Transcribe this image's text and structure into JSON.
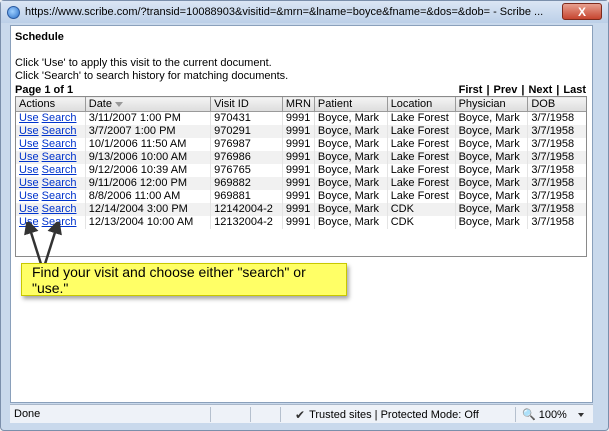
{
  "window": {
    "title": "https://www.scribe.com/?transid=10088903&visitid=&mrn=&lname=boyce&fname=&dos=&dob= - Scribe ...",
    "close_label": "X"
  },
  "page": {
    "title": "Schedule",
    "instruction_use": "Click 'Use' to apply this visit to the current document.",
    "instruction_search": "Click 'Search' to search history for matching documents.",
    "page_info": "Page 1 of 1"
  },
  "pager": {
    "first": "First",
    "prev": "Prev",
    "next": "Next",
    "last": "Last",
    "sep": "|"
  },
  "table": {
    "headers": {
      "actions": "Actions",
      "date": "Date",
      "visit_id": "Visit ID",
      "mrn": "MRN",
      "patient": "Patient",
      "location": "Location",
      "physician": "Physician",
      "dob": "DOB"
    },
    "use_label": "Use",
    "search_label": "Search",
    "rows": [
      {
        "date": "3/11/2007 1:00 PM",
        "visit_id": "970431",
        "mrn": "9991",
        "patient": "Boyce, Mark",
        "location": "Lake Forest",
        "physician": "Boyce, Mark",
        "dob": "3/7/1958"
      },
      {
        "date": "3/7/2007 1:00 PM",
        "visit_id": "970291",
        "mrn": "9991",
        "patient": "Boyce, Mark",
        "location": "Lake Forest",
        "physician": "Boyce, Mark",
        "dob": "3/7/1958"
      },
      {
        "date": "10/1/2006 11:50 AM",
        "visit_id": "976987",
        "mrn": "9991",
        "patient": "Boyce, Mark",
        "location": "Lake Forest",
        "physician": "Boyce, Mark",
        "dob": "3/7/1958"
      },
      {
        "date": "9/13/2006 10:00 AM",
        "visit_id": "976986",
        "mrn": "9991",
        "patient": "Boyce, Mark",
        "location": "Lake Forest",
        "physician": "Boyce, Mark",
        "dob": "3/7/1958"
      },
      {
        "date": "9/12/2006 10:39 AM",
        "visit_id": "976765",
        "mrn": "9991",
        "patient": "Boyce, Mark",
        "location": "Lake Forest",
        "physician": "Boyce, Mark",
        "dob": "3/7/1958"
      },
      {
        "date": "9/11/2006 12:00 PM",
        "visit_id": "969882",
        "mrn": "9991",
        "patient": "Boyce, Mark",
        "location": "Lake Forest",
        "physician": "Boyce, Mark",
        "dob": "3/7/1958"
      },
      {
        "date": "8/8/2006 11:00 AM",
        "visit_id": "969881",
        "mrn": "9991",
        "patient": "Boyce, Mark",
        "location": "Lake Forest",
        "physician": "Boyce, Mark",
        "dob": "3/7/1958"
      },
      {
        "date": "12/14/2004 3:00 PM",
        "visit_id": "12142004-2",
        "mrn": "9991",
        "patient": "Boyce, Mark",
        "location": "CDK",
        "physician": "Boyce, Mark",
        "dob": "3/7/1958"
      },
      {
        "date": "12/13/2004 10:00 AM",
        "visit_id": "12132004-2",
        "mrn": "9991",
        "patient": "Boyce, Mark",
        "location": "CDK",
        "physician": "Boyce, Mark",
        "dob": "3/7/1958"
      }
    ]
  },
  "callout": {
    "text": "Find your visit and choose either \"search\" or \"use.\""
  },
  "statusbar": {
    "done": "Done",
    "zone": "Trusted sites | Protected Mode: Off",
    "zoom": "100%"
  },
  "icons": {
    "title": "globe-icon",
    "sort": "sort-desc-icon",
    "zone": "checkmark-icon",
    "zoom": "magnifier-icon"
  }
}
